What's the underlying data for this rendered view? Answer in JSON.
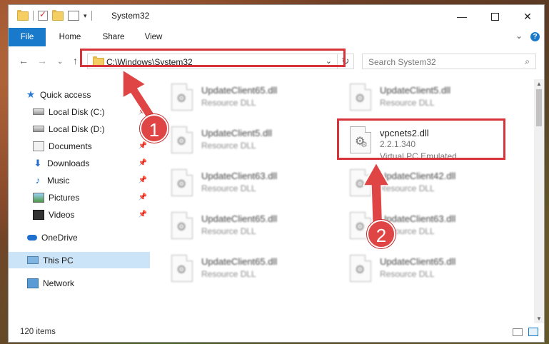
{
  "window": {
    "title": "System32",
    "minimize": "—",
    "close": "✕"
  },
  "ribbon": {
    "tabs": [
      "File",
      "Home",
      "Share",
      "View"
    ],
    "collapse_glyph": "⌄",
    "help_glyph": "?"
  },
  "nav": {
    "back": "←",
    "forward": "→",
    "recent": "⌄",
    "up": "↑",
    "address": "C:\\Windows\\System32",
    "address_dropdown": "⌄",
    "refresh": "↻",
    "search_placeholder": "Search System32",
    "search_glyph": "⌕"
  },
  "sidebar": {
    "pin_glyph": "📌",
    "items": [
      {
        "label": "Quick access",
        "icon": "star-icon"
      },
      {
        "label": "Local Disk (C:)",
        "icon": "disk-icon"
      },
      {
        "label": "Local Disk (D:)",
        "icon": "disk-icon"
      },
      {
        "label": "Documents",
        "icon": "documents-icon"
      },
      {
        "label": "Downloads",
        "icon": "downloads-icon"
      },
      {
        "label": "Music",
        "icon": "music-icon"
      },
      {
        "label": "Pictures",
        "icon": "pictures-icon"
      },
      {
        "label": "Videos",
        "icon": "videos-icon"
      },
      {
        "label": "OneDrive",
        "icon": "onedrive-icon"
      },
      {
        "label": "This PC",
        "icon": "pc-icon"
      },
      {
        "label": "Network",
        "icon": "network-icon"
      }
    ]
  },
  "files": {
    "left_column": [
      {
        "name": "UpdateClient65.dll",
        "type": "Resource DLL"
      },
      {
        "name": "UpdateClient5.dll",
        "type": "Resource DLL"
      },
      {
        "name": "UpdateClient63.dll",
        "type": "Resource DLL"
      },
      {
        "name": "UpdateClient65.dll",
        "type": "Resource DLL"
      },
      {
        "name": "UpdateClient65.dll",
        "type": "Resource DLL"
      }
    ],
    "right_column": [
      {
        "name": "UpdateClient5.dll",
        "type": "Resource DLL"
      },
      {
        "name": "UpdateClient42.dll",
        "type": "Resource DLL"
      },
      {
        "name": "UpdateClient63.dll",
        "type": "Resource DLL"
      },
      {
        "name": "UpdateClient65.dll",
        "type": "Resource DLL"
      }
    ],
    "target": {
      "name": "vpcnets2.dll",
      "version": "2.2.1.340",
      "description": "Virtual PC Emulated..."
    }
  },
  "status": {
    "item_count": "120 items"
  },
  "annotations": {
    "step1": "1",
    "step2": "2",
    "highlight_color": "#d6333a"
  },
  "colors": {
    "file_tab": "#1979ca",
    "selected_nav": "#cce4f7"
  }
}
